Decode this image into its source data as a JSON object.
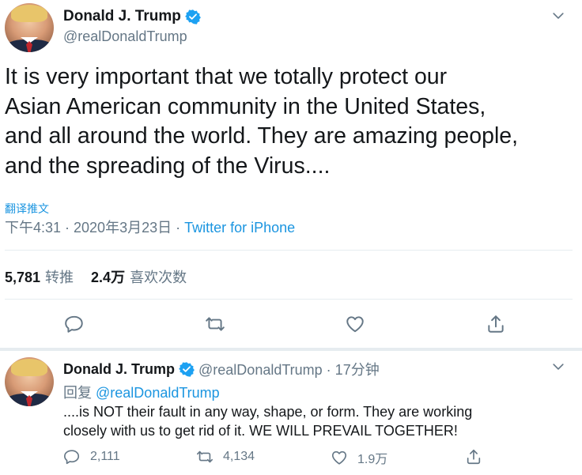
{
  "colors": {
    "link": "#1b95e0",
    "muted": "#657786",
    "text": "#14171a",
    "divider": "#e6ecf0",
    "verified": "#1da1f2"
  },
  "main_tweet": {
    "display_name": "Donald J. Trump",
    "handle": "@realDonaldTrump",
    "text": "It is very important that we totally protect our\nAsian American community in the United States,\nand all around the world. They are amazing people,\nand the spreading of the Virus....",
    "translate_label": "翻译推文",
    "time": "下午4:31 · 2020年3月23日 · ",
    "source": "Twitter for iPhone",
    "retweets_count": "5,781",
    "retweets_label": "转推",
    "likes_count": "2.4万",
    "likes_label": "喜欢次数",
    "actions": [
      "reply-icon",
      "retweet-icon",
      "like-icon",
      "share-icon"
    ]
  },
  "reply_tweet": {
    "display_name": "Donald J. Trump",
    "handle_time": "@realDonaldTrump · 17分钟",
    "reply_prefix": "回复 ",
    "reply_mention": "@realDonaldTrump",
    "text": "....is NOT their fault in any way, shape, or form. They are working\nclosely with us to get rid of it. WE WILL PREVAIL TOGETHER!",
    "reply_count": "2,111",
    "retweet_count": "4,134",
    "like_count": "1.9万"
  }
}
